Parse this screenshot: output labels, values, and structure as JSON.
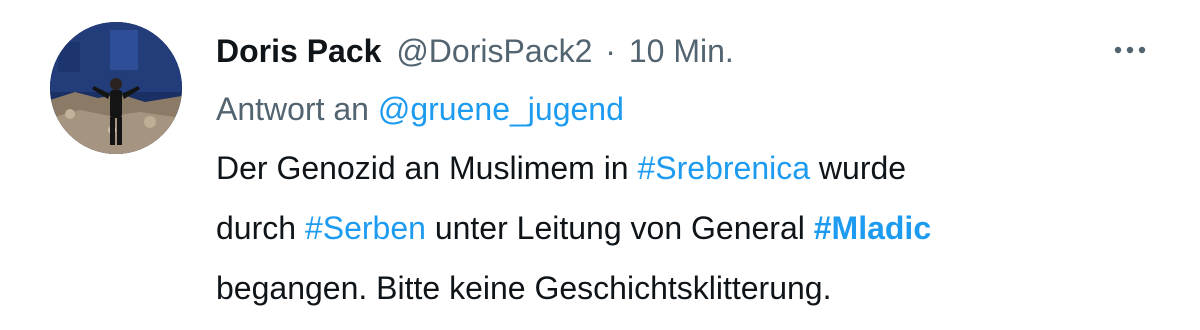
{
  "tweet": {
    "author": {
      "display_name": "Doris Pack",
      "handle": "@DorisPack2"
    },
    "separator": "·",
    "time": "10 Min.",
    "more_icon": "more-horizontal-icon",
    "reply_prefix": "Antwort an",
    "reply_to": "@gruene_jugend",
    "text": {
      "line1_a": "Der Genozid an Muslimem in ",
      "hashtag1": "#Srebrenica",
      "line1_b": " wurde",
      "line2_a": "durch ",
      "hashtag2": "#Serben",
      "line2_b": " unter Leitung von General ",
      "hashtag3": "#Mladic",
      "line3": "begangen. Bitte keine Geschichtsklitterung."
    }
  },
  "colors": {
    "link": "#1d9bf0",
    "text": "#0f1419",
    "secondary": "#536471"
  }
}
